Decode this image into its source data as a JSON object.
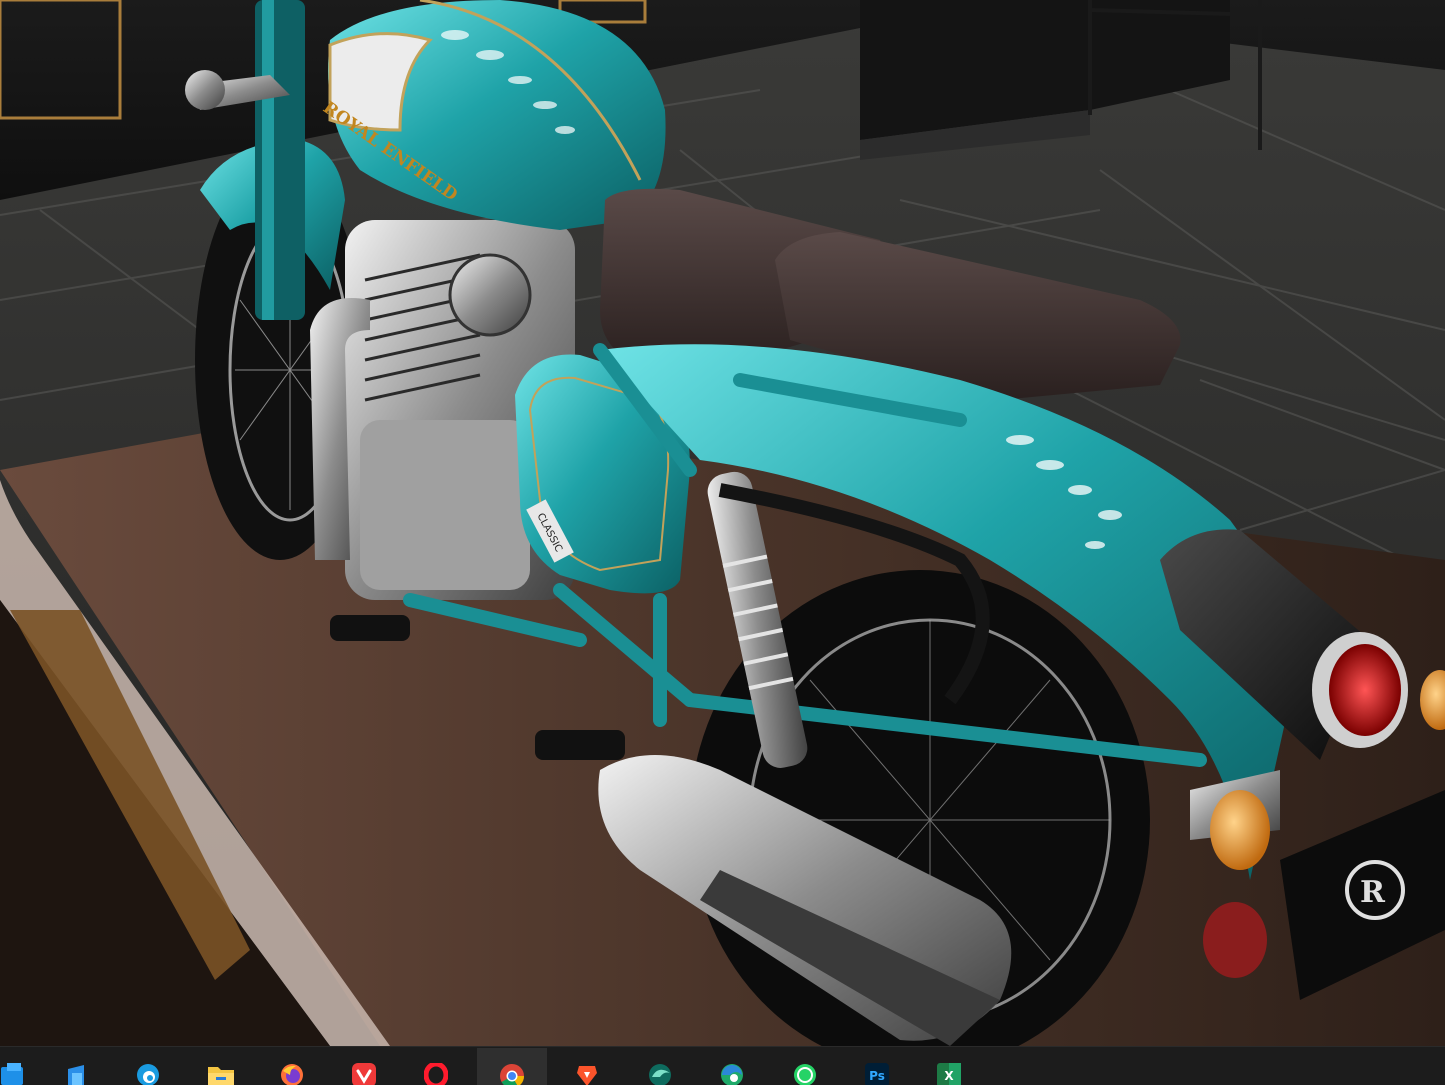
{
  "scene": {
    "subject": "3D motorcycle configurator render",
    "tank_brand_text": "ROYAL ENFIELD",
    "side_panel_badge": "CLASSIC",
    "colors": {
      "body_teal": "#1fa3a8",
      "seat_brown": "#3b2f2e",
      "floor_dark": "#2b2b2a",
      "platform_wood": "#5a4035"
    }
  },
  "taskbar": {
    "background": "#1c1c1c",
    "items": [
      {
        "id": "file-explorer-partial",
        "icon": "file-explorer-icon",
        "active": false
      },
      {
        "id": "microsoft-store",
        "icon": "store-icon",
        "active": false
      },
      {
        "id": "cortana-edge-beta",
        "icon": "edge-beta-icon",
        "active": false
      },
      {
        "id": "file-explorer",
        "icon": "folder-icon",
        "active": false
      },
      {
        "id": "firefox",
        "icon": "firefox-icon",
        "active": false
      },
      {
        "id": "vivaldi",
        "icon": "vivaldi-icon",
        "active": false
      },
      {
        "id": "opera",
        "icon": "opera-icon",
        "active": false
      },
      {
        "id": "chrome",
        "icon": "chrome-icon",
        "active": true
      },
      {
        "id": "brave",
        "icon": "brave-icon",
        "active": false
      },
      {
        "id": "edge-dev",
        "icon": "edge-dev-icon",
        "active": false
      },
      {
        "id": "edge",
        "icon": "edge-icon",
        "active": false
      },
      {
        "id": "whatsapp",
        "icon": "whatsapp-icon",
        "active": false
      },
      {
        "id": "photoshop",
        "icon": "photoshop-icon",
        "label": "Ps",
        "active": false
      },
      {
        "id": "excel",
        "icon": "excel-icon",
        "label": "X",
        "active": false
      }
    ]
  }
}
